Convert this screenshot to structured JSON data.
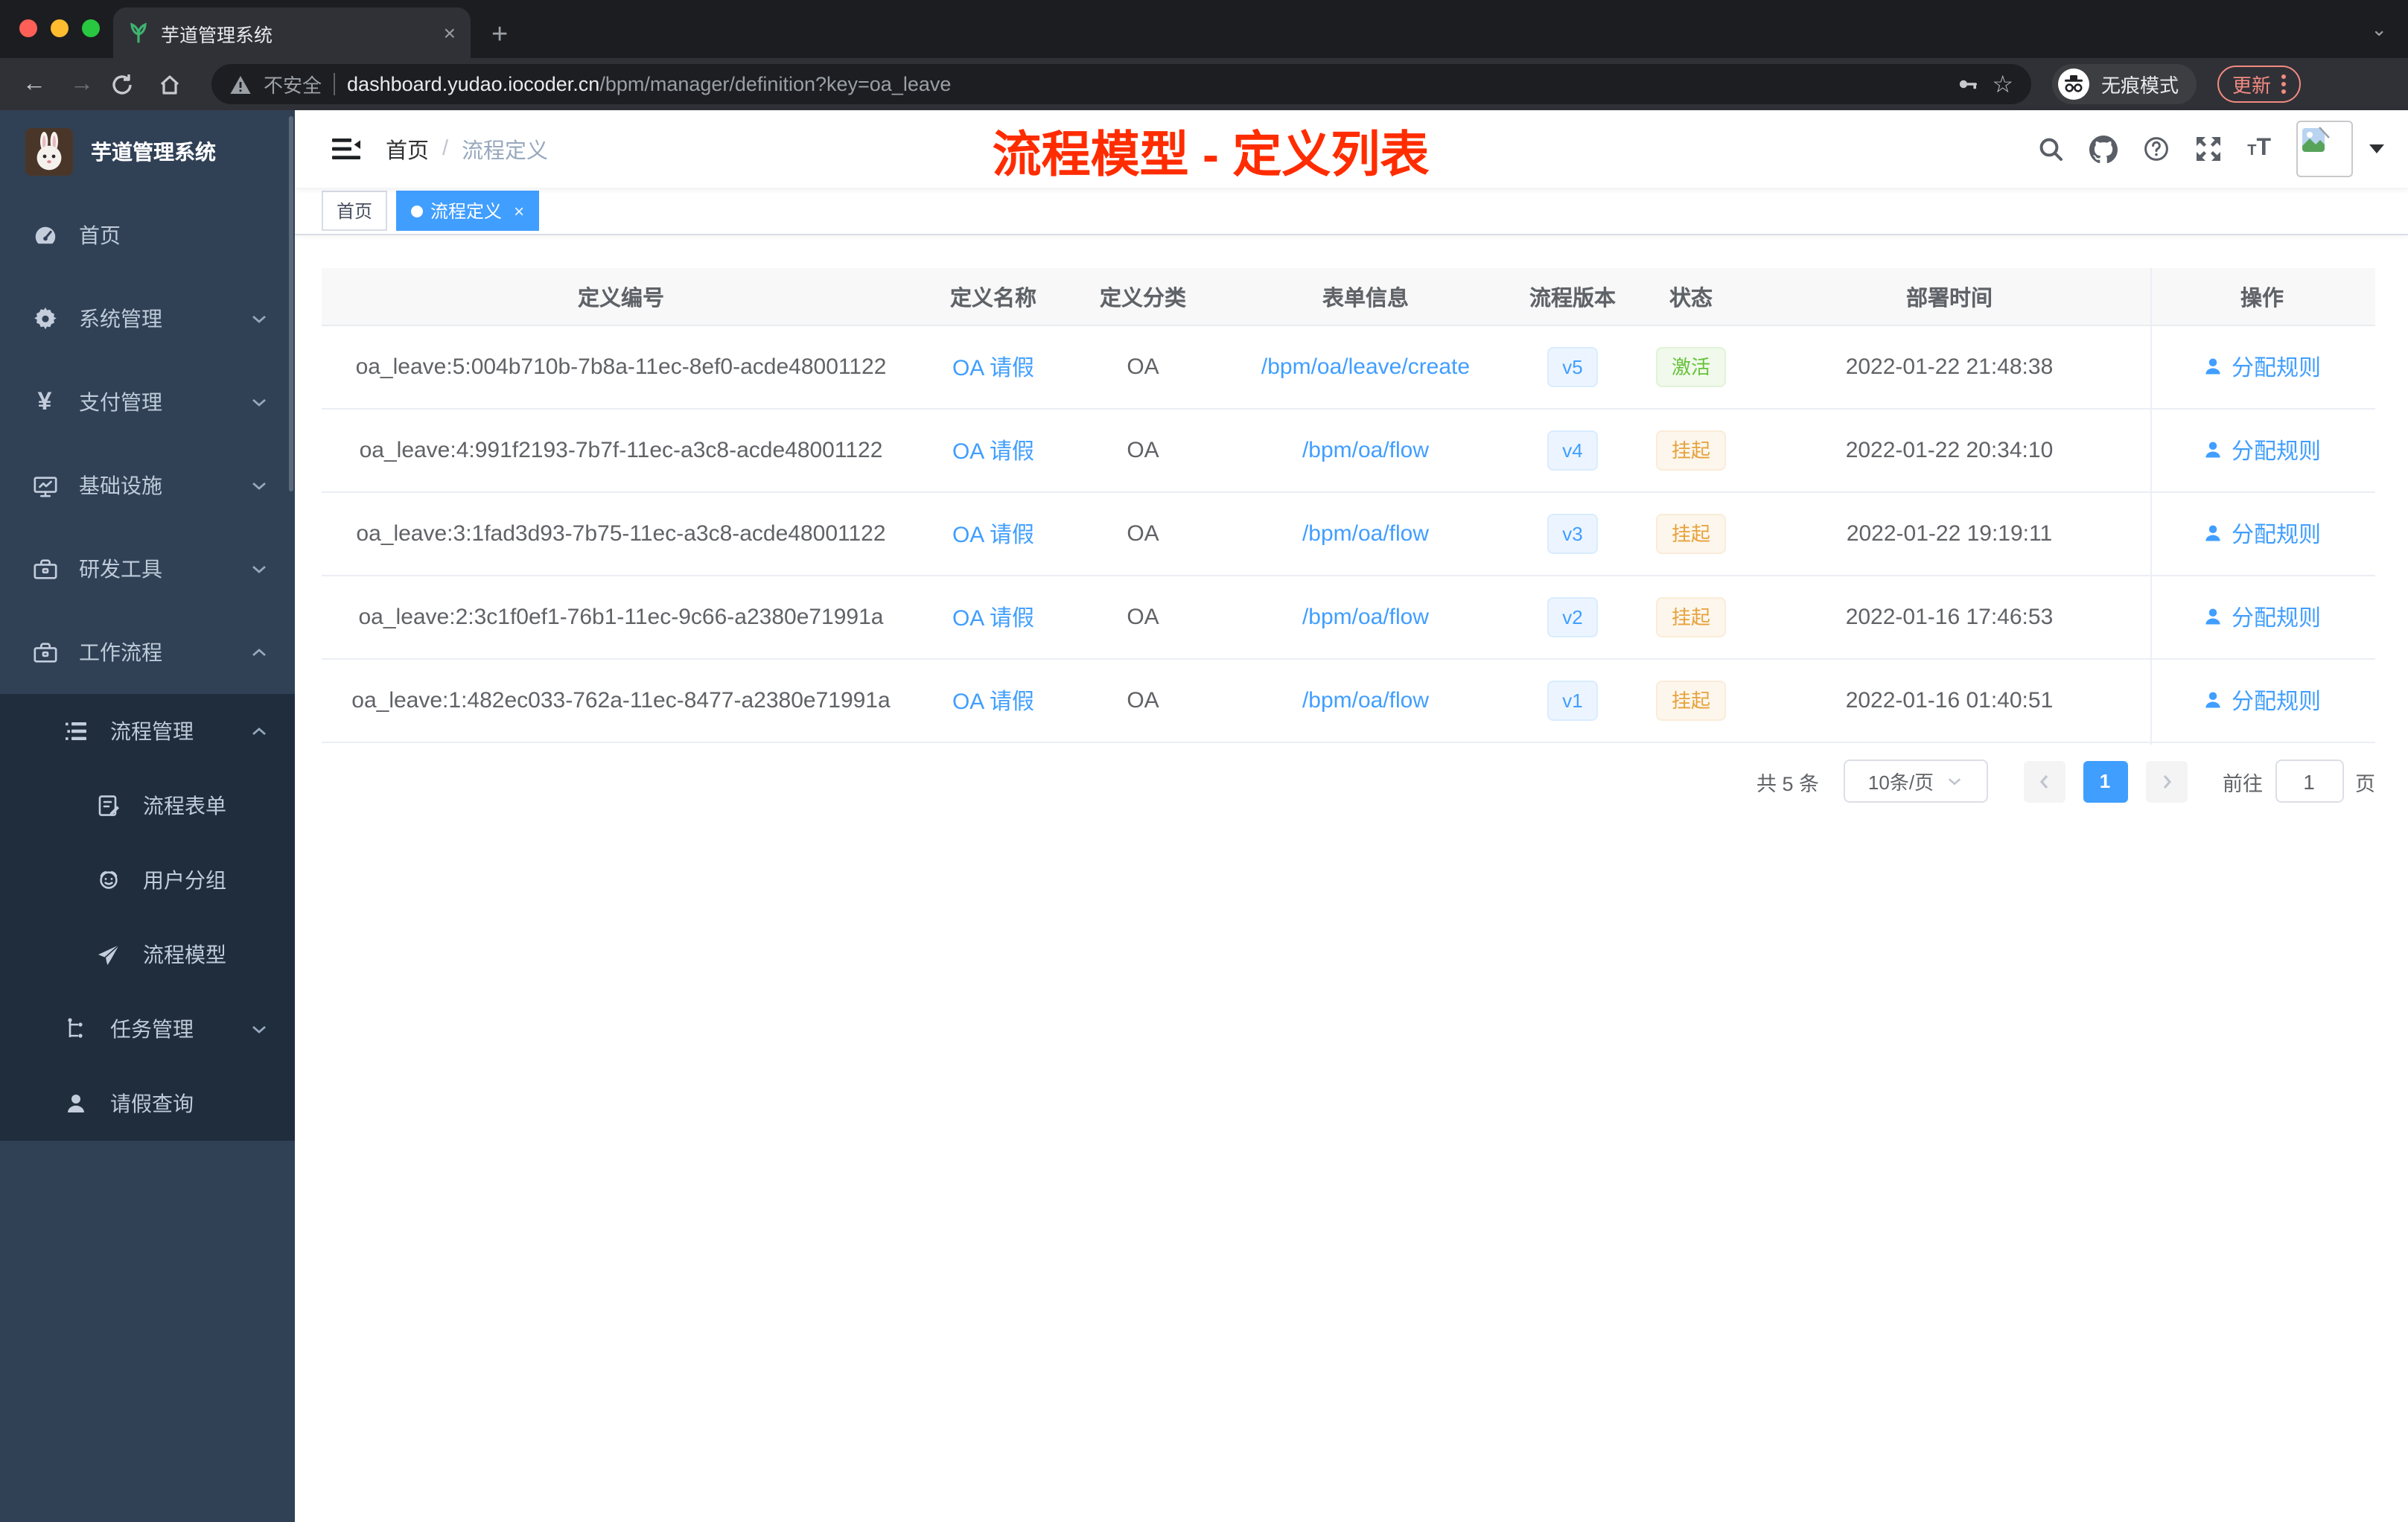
{
  "browser": {
    "tab_title": "芋道管理系统",
    "url": {
      "security_label": "不安全",
      "host": "dashboard.yudao.iocoder.cn",
      "path": "/bpm/manager/definition?key=oa_leave"
    },
    "incognito_label": "无痕模式",
    "update_label": "更新",
    "glyphs": {
      "close": "×",
      "new_tab": "+",
      "tab_search": "⌄",
      "back": "←",
      "forward": "→",
      "star": "☆"
    }
  },
  "sidebar": {
    "title": "芋道管理系统",
    "items": [
      {
        "label": "首页",
        "icon": "dashboard-icon",
        "level": 1
      },
      {
        "label": "系统管理",
        "icon": "gear-icon",
        "level": 1,
        "chevron": "down"
      },
      {
        "label": "支付管理",
        "icon": "yen-icon",
        "level": 1,
        "chevron": "down",
        "yen": "¥"
      },
      {
        "label": "基础设施",
        "icon": "monitor-icon",
        "level": 1,
        "chevron": "down"
      },
      {
        "label": "研发工具",
        "icon": "toolbox-icon",
        "level": 1,
        "chevron": "down"
      },
      {
        "label": "工作流程",
        "icon": "briefcase-icon",
        "level": 1,
        "chevron": "up"
      },
      {
        "label": "流程管理",
        "icon": "list-tree-icon",
        "level": 2,
        "chevron": "up"
      },
      {
        "label": "流程表单",
        "icon": "form-icon",
        "level": 3
      },
      {
        "label": "用户分组",
        "icon": "face-icon",
        "level": 3
      },
      {
        "label": "流程模型",
        "icon": "plane-icon",
        "level": 3
      },
      {
        "label": "任务管理",
        "icon": "tree-icon",
        "level": 2,
        "chevron": "down"
      },
      {
        "label": "请假查询",
        "icon": "person-icon",
        "level": 2
      }
    ]
  },
  "navbar": {
    "breadcrumb": {
      "home": "首页",
      "separator": "/",
      "current": "流程定义"
    },
    "annotation": "流程模型 - 定义列表"
  },
  "tags": [
    {
      "label": "首页",
      "active": false
    },
    {
      "label": "流程定义",
      "active": true,
      "close": "×"
    }
  ],
  "table": {
    "columns": [
      "定义编号",
      "定义名称",
      "定义分类",
      "表单信息",
      "流程版本",
      "状态",
      "部署时间",
      "操作"
    ],
    "rows": [
      {
        "id": "oa_leave:5:004b710b-7b8a-11ec-8ef0-acde48001122",
        "name": "OA 请假",
        "category": "OA",
        "form": "/bpm/oa/leave/create",
        "version": "v5",
        "status": "激活",
        "status_type": "success",
        "time": "2022-01-22 21:48:38",
        "action": "分配规则"
      },
      {
        "id": "oa_leave:4:991f2193-7b7f-11ec-a3c8-acde48001122",
        "name": "OA 请假",
        "category": "OA",
        "form": "/bpm/oa/flow",
        "version": "v4",
        "status": "挂起",
        "status_type": "warning",
        "time": "2022-01-22 20:34:10",
        "action": "分配规则"
      },
      {
        "id": "oa_leave:3:1fad3d93-7b75-11ec-a3c8-acde48001122",
        "name": "OA 请假",
        "category": "OA",
        "form": "/bpm/oa/flow",
        "version": "v3",
        "status": "挂起",
        "status_type": "warning",
        "time": "2022-01-22 19:19:11",
        "action": "分配规则"
      },
      {
        "id": "oa_leave:2:3c1f0ef1-76b1-11ec-9c66-a2380e71991a",
        "name": "OA 请假",
        "category": "OA",
        "form": "/bpm/oa/flow",
        "version": "v2",
        "status": "挂起",
        "status_type": "warning",
        "time": "2022-01-16 17:46:53",
        "action": "分配规则"
      },
      {
        "id": "oa_leave:1:482ec033-762a-11ec-8477-a2380e71991a",
        "name": "OA 请假",
        "category": "OA",
        "form": "/bpm/oa/flow",
        "version": "v1",
        "status": "挂起",
        "status_type": "warning",
        "time": "2022-01-16 01:40:51",
        "action": "分配规则"
      }
    ]
  },
  "pagination": {
    "total": "共 5 条",
    "page_size": "10条/页",
    "current_page": "1",
    "goto_label": "前往",
    "goto_value": "1",
    "unit_label": "页"
  },
  "colors": {
    "accent_blue": "#409eff",
    "sidebar_bg": "#304156",
    "submenu_bg": "#1f2d3d",
    "annotation_red": "#ff2c00",
    "status_active_green": "#67c23a",
    "status_suspend_orange": "#e6a23c",
    "update_red": "#f28b82"
  }
}
